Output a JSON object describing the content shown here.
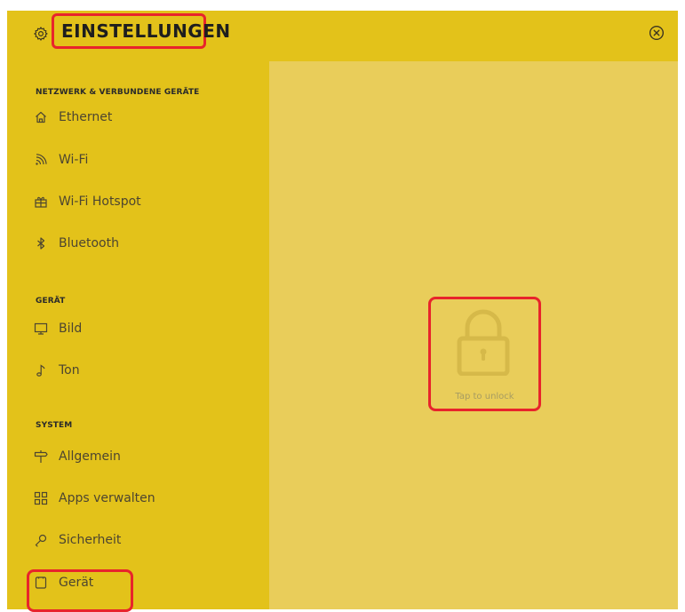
{
  "header": {
    "title": "EINSTELLUNGEN",
    "settings_icon": "gear-icon",
    "close_icon": "close-circle-icon"
  },
  "sidebar": {
    "sections": [
      {
        "title": "NETZWERK & VERBUNDENE GERÄTE",
        "items": [
          {
            "label": "Ethernet",
            "icon": "home-icon"
          },
          {
            "label": "Wi-Fi",
            "icon": "wifi-icon"
          },
          {
            "label": "Wi-Fi Hotspot",
            "icon": "hotspot-icon"
          },
          {
            "label": "Bluetooth",
            "icon": "bluetooth-icon"
          }
        ]
      },
      {
        "title": "GERÄT",
        "items": [
          {
            "label": "Bild",
            "icon": "monitor-icon"
          },
          {
            "label": "Ton",
            "icon": "music-note-icon"
          }
        ]
      },
      {
        "title": "SYSTEM",
        "items": [
          {
            "label": "Allgemein",
            "icon": "signpost-icon"
          },
          {
            "label": "Apps verwalten",
            "icon": "apps-grid-icon"
          },
          {
            "label": "Sicherheit",
            "icon": "key-icon"
          },
          {
            "label": "Gerät",
            "icon": "device-icon"
          }
        ]
      }
    ]
  },
  "main": {
    "lock_icon": "lock-icon",
    "unlock_label": "Tap to unlock"
  },
  "colors": {
    "header_bg": "#e3c21a",
    "sidebar_bg": "#e3c21a",
    "content_bg": "#e9cd5a",
    "highlight": "#e8242b"
  }
}
